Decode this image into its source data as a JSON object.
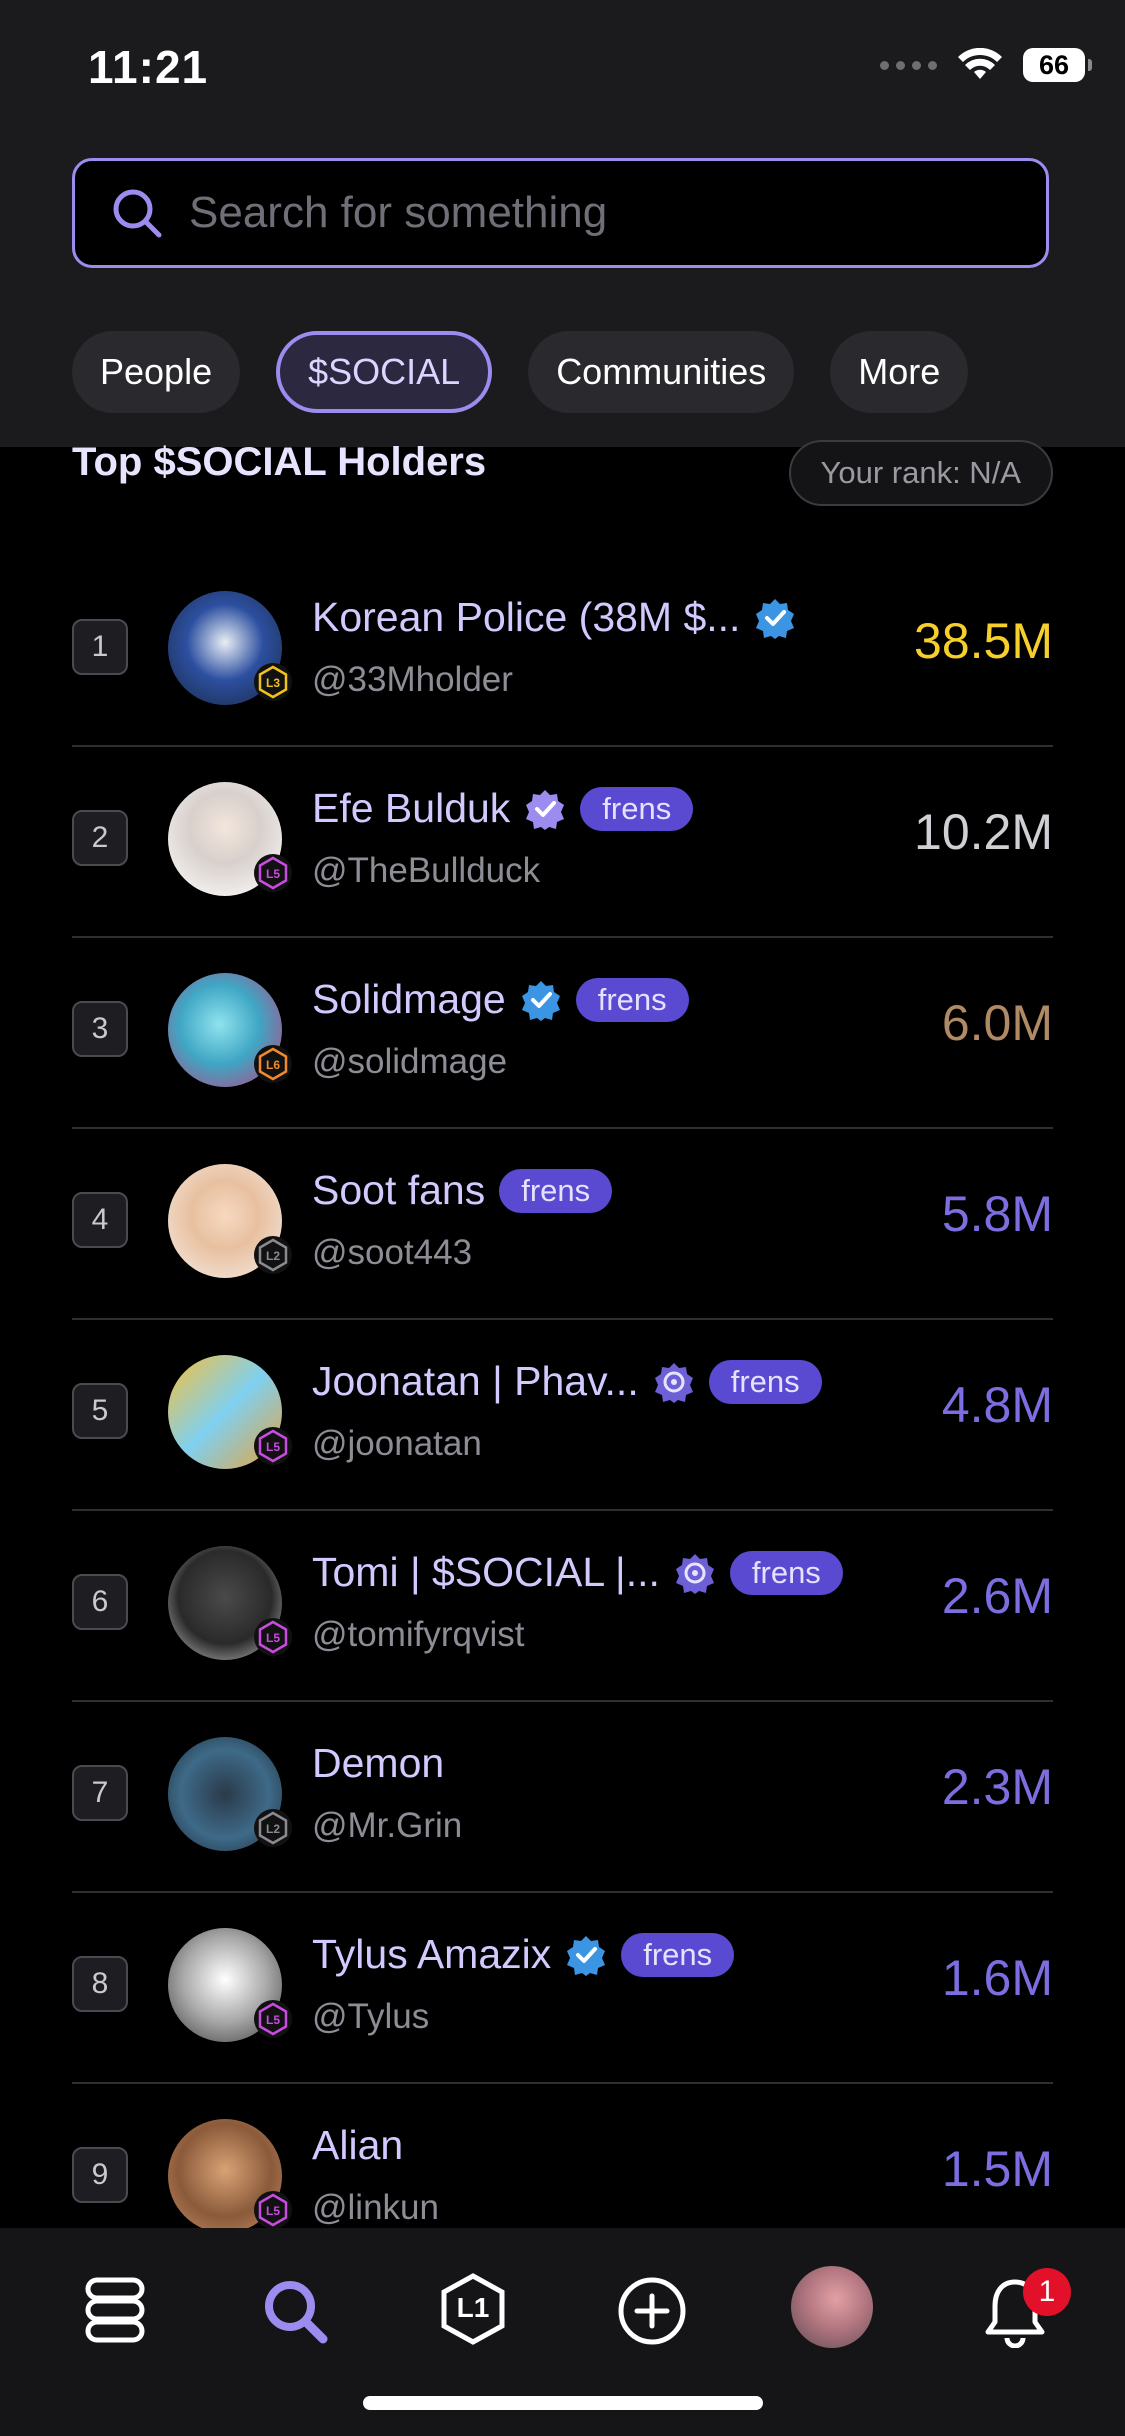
{
  "status_bar": {
    "time": "11:21",
    "battery": "66"
  },
  "search": {
    "placeholder": "Search for something"
  },
  "tabs": [
    {
      "label": "People",
      "active": false
    },
    {
      "label": "$SOCIAL",
      "active": true
    },
    {
      "label": "Communities",
      "active": false
    },
    {
      "label": "More",
      "active": false
    }
  ],
  "section": {
    "title": "Top $SOCIAL Holders",
    "rank_label": "Your rank: N/A"
  },
  "holders": [
    {
      "rank": "1",
      "name": "Korean Police (38M $...",
      "handle": "@33Mholder",
      "value": "38.5M",
      "value_color": "#f6cf2b",
      "badge": "blue-check",
      "frens": false,
      "level": "L3",
      "level_color": "#f1c21b"
    },
    {
      "rank": "2",
      "name": "Efe Bulduk",
      "handle": "@TheBullduck",
      "value": "10.2M",
      "value_color": "#cfcfd4",
      "badge": "purple-check",
      "frens": true,
      "level": "L5",
      "level_color": "#c94ce0"
    },
    {
      "rank": "3",
      "name": "Solidmage",
      "handle": "@solidmage",
      "value": "6.0M",
      "value_color": "#b08a65",
      "badge": "blue-check",
      "frens": true,
      "level": "L6",
      "level_color": "#f08a2c"
    },
    {
      "rank": "4",
      "name": "Soot fans",
      "handle": "@soot443",
      "value": "5.8M",
      "value_color": "#7c6ee0",
      "badge": "",
      "frens": true,
      "level": "L2",
      "level_color": "#8a8a90"
    },
    {
      "rank": "5",
      "name": "Joonatan | Phav...",
      "handle": "@joonatan",
      "value": "4.8M",
      "value_color": "#7c6ee0",
      "badge": "purple-seal",
      "frens": true,
      "level": "L5",
      "level_color": "#c94ce0"
    },
    {
      "rank": "6",
      "name": "Tomi | $SOCIAL |...",
      "handle": "@tomifyrqvist",
      "value": "2.6M",
      "value_color": "#7c6ee0",
      "badge": "purple-seal",
      "frens": true,
      "level": "L5",
      "level_color": "#c94ce0"
    },
    {
      "rank": "7",
      "name": "Demon",
      "handle": "@Mr.Grin",
      "value": "2.3M",
      "value_color": "#7c6ee0",
      "badge": "",
      "frens": false,
      "level": "L2",
      "level_color": "#8a8a90"
    },
    {
      "rank": "8",
      "name": "Tylus Amazix",
      "handle": "@Tylus",
      "value": "1.6M",
      "value_color": "#7c6ee0",
      "badge": "blue-check",
      "frens": true,
      "level": "L5",
      "level_color": "#c94ce0"
    },
    {
      "rank": "9",
      "name": "Alian",
      "handle": "@linkun",
      "value": "1.5M",
      "value_color": "#7c6ee0",
      "badge": "",
      "frens": false,
      "level": "L5",
      "level_color": "#c94ce0"
    }
  ],
  "frens_label": "frens",
  "bottom_nav": {
    "items": [
      "home-icon",
      "search-icon",
      "level-icon",
      "add-icon",
      "profile-avatar",
      "bell-icon"
    ],
    "level_label": "L1",
    "notification_count": "1"
  },
  "colors": {
    "accent": "#9d8cf0",
    "gold": "#f6cf2b",
    "purple": "#7c6ee0",
    "notif": "#e3102a"
  }
}
